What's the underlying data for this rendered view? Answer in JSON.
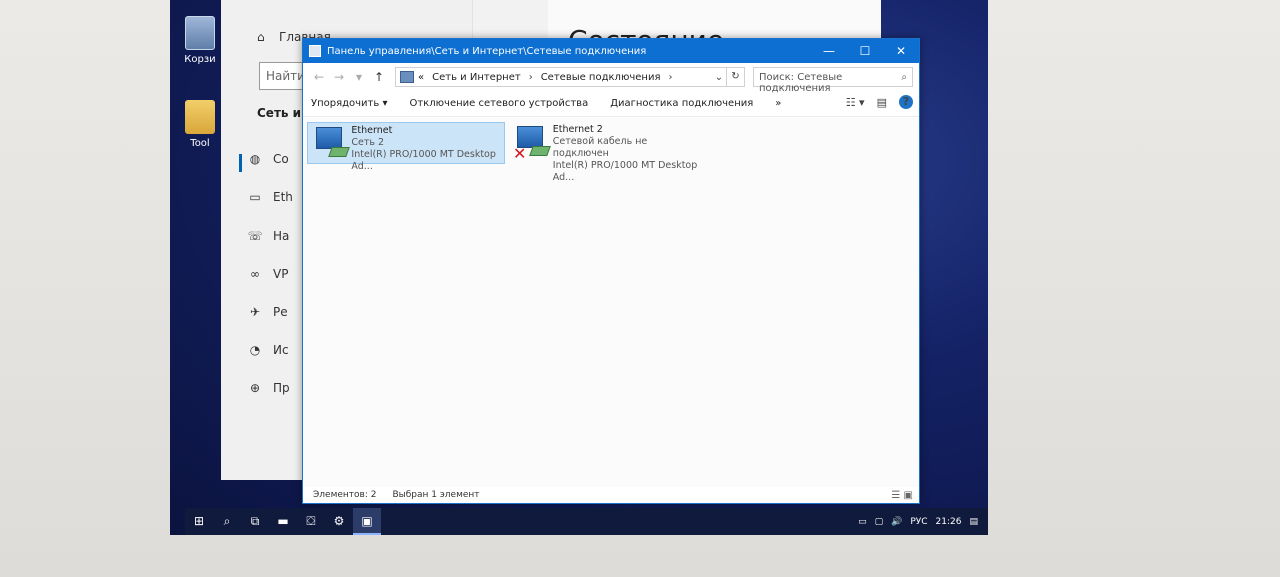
{
  "desktop": {
    "icons": [
      {
        "label": "Корзи"
      },
      {
        "label": "Tool"
      }
    ]
  },
  "settings": {
    "heading": "Состояние",
    "home": "Главная",
    "search_placeholder": "Найти",
    "group": "Сеть и И",
    "items": [
      {
        "icon": "globe-icon",
        "label": "Со"
      },
      {
        "icon": "ethernet-icon",
        "label": "Eth"
      },
      {
        "icon": "dialup-icon",
        "label": "На"
      },
      {
        "icon": "vpn-icon",
        "label": "VP"
      },
      {
        "icon": "airplane-icon",
        "label": "Ре"
      },
      {
        "icon": "data-usage-icon",
        "label": "Ис"
      },
      {
        "icon": "proxy-icon",
        "label": "Пр"
      }
    ]
  },
  "explorer": {
    "title": "Панель управления\\Сеть и Интернет\\Сетевые подключения",
    "breadcrumb": {
      "prefix": "«",
      "items": [
        "Сеть и Интернет",
        "Сетевые подключения"
      ]
    },
    "search_placeholder": "Поиск: Сетевые подключения",
    "toolbar": {
      "organize": "Упорядочить ▾",
      "disable": "Отключение сетевого устройства",
      "diagnose": "Диагностика подключения",
      "more": "»"
    },
    "adapters": [
      {
        "name": "Ethernet",
        "network": "Сеть 2",
        "device": "Intel(R) PRO/1000 MT Desktop Ad...",
        "selected": true,
        "disconnected": false
      },
      {
        "name": "Ethernet 2",
        "network": "Сетевой кабель не подключен",
        "device": "Intel(R) PRO/1000 MT Desktop Ad...",
        "selected": false,
        "disconnected": true
      }
    ],
    "status": {
      "count": "Элементов: 2",
      "selected": "Выбран 1 элемент"
    }
  },
  "taskbar": {
    "language": "РУС",
    "time": "21:26"
  }
}
